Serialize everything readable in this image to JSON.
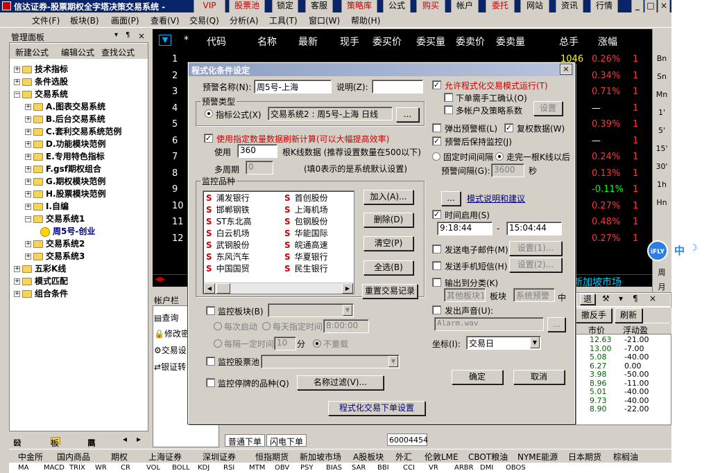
{
  "titlebar": {
    "title": "信达证券-股票期权全字塔决策交易系统 -",
    "buttons": [
      "VIP",
      "股票池",
      "锁定",
      "客服",
      "策略库",
      "公式",
      "购买",
      "帐户",
      "委托",
      "网站",
      "资讯",
      "行情"
    ]
  },
  "menubar": [
    "文件(F)",
    "板块(B)",
    "画面(P)",
    "查看(V)",
    "交易(Q)",
    "分析(A)",
    "工具(T)",
    "窗口(W)",
    "帮助(H)"
  ],
  "leftpanel": {
    "title": "管理面板",
    "tools": [
      "新建公式",
      "编辑公式",
      "查找公式"
    ],
    "tree": [
      {
        "label": "技术指标",
        "level": 0
      },
      {
        "label": "条件选股",
        "level": 0
      },
      {
        "label": "交易系统",
        "level": 0
      },
      {
        "label": "A.图表交易系统",
        "level": 1
      },
      {
        "label": "B.后台交易系统",
        "level": 1
      },
      {
        "label": "C.套利交易系统范例",
        "level": 1
      },
      {
        "label": "D.功能模块范例",
        "level": 1
      },
      {
        "label": "E.专用特色指标",
        "level": 1
      },
      {
        "label": "F.gsf期权组合",
        "level": 1
      },
      {
        "label": "G.期权模块范例",
        "level": 1
      },
      {
        "label": "H.股票模块范例",
        "level": 1
      },
      {
        "label": "I.自编",
        "level": 1
      },
      {
        "label": "交易系统1",
        "level": 1
      },
      {
        "label": "周5号-创业",
        "level": 2
      },
      {
        "label": "交易系统2",
        "level": 1
      },
      {
        "label": "交易系统3",
        "level": 1
      },
      {
        "label": "五彩K线",
        "level": 0
      },
      {
        "label": "模式匹配",
        "level": 0
      },
      {
        "label": "组合条件",
        "level": 0
      }
    ],
    "tabs": [
      "公式",
      "板块",
      "高级"
    ]
  },
  "grid": {
    "headers": [
      "*",
      "代码",
      "名称",
      "最新",
      "现手",
      "委买价",
      "委买量",
      "委卖价",
      "委卖量",
      "总手",
      "涨幅"
    ],
    "rownums": [
      "1",
      "2",
      "3",
      "4",
      "5",
      "6",
      "7",
      "8",
      "9",
      "10",
      "11",
      "12"
    ],
    "zongshou": [
      "1046",
      "",
      "",
      "",
      "",
      "",
      "",
      "",
      "",
      "",
      "",
      ""
    ],
    "zhangfu": [
      "0.26%",
      "0.34%",
      "0.71%",
      "—",
      "0.39%",
      "—",
      "0.24%",
      "0.13%",
      "-0.11%",
      "0.27%",
      "0.48%",
      "0.27%"
    ],
    "market_tab": "新加坡市场"
  },
  "vtool": [
    "Bn",
    "Sn",
    "Mn",
    "1'",
    "5'",
    "15'",
    "30'",
    "1h",
    "Hn",
    "周",
    "月",
    "季"
  ],
  "ifly": {
    "logo": "iFLY",
    "lang": "中"
  },
  "account": {
    "title": "帐户栏",
    "items": [
      "查询",
      "修改密",
      "交易设",
      "银证转"
    ]
  },
  "rightbottom": {
    "buttons": [
      "撤反手",
      "刷新"
    ],
    "headers": [
      "市价",
      "浮动盈"
    ],
    "rows": [
      [
        "12.63",
        "-21.00"
      ],
      [
        "13.00",
        "-7.00"
      ],
      [
        "5.08",
        "-40.00"
      ],
      [
        "6.27",
        "0.00"
      ],
      [
        "3.98",
        "-50.00"
      ],
      [
        "8.96",
        "-11.00"
      ],
      [
        "5.01",
        "-40.00"
      ],
      [
        "9.73",
        "-40.00"
      ],
      [
        "8.90",
        "-22.00"
      ]
    ],
    "back": "退"
  },
  "bottomtabs": [
    "普通下单",
    "闪电下单"
  ],
  "statuscode": "60004454",
  "marketbar": [
    "中金所",
    "国内商品",
    "期权",
    "上海证券",
    "深圳证券",
    "恒指期货",
    "新加坡市场",
    "A股板块",
    "外汇",
    "伦敦LME",
    "CBOT粮油",
    "NYME能源",
    "日本期货",
    "棕榈油"
  ],
  "indexbar": [
    "MA",
    "MACD",
    "TRIX",
    "WR",
    "CR",
    "VOL",
    "BOLL",
    "KDJ",
    "RSI",
    "MTM",
    "OBV",
    "PSY",
    "BIAS",
    "SAR",
    "BBI",
    "CCI",
    "VR",
    "ARBR",
    "DMI",
    "OBOS"
  ],
  "dialog": {
    "title": "程式化条件设定",
    "close": "×",
    "name_label": "预警名称(N):",
    "name_value": "周5号-上海",
    "desc_label": "说明(Z):",
    "desc_value": "",
    "type_group": "预警类型",
    "type_radio": "指标公式(X)",
    "type_value": "交易系统2 : 周5号-上海 日线",
    "type_btn": "...",
    "use_count_check": "使用指定数量数据刷新计算(可以大幅提高效率)",
    "use_label": "使用",
    "use_value": "360",
    "use_note": "根K线数据 (推荐设置数量在500以下)",
    "period_label": "多周期",
    "period_value": "0",
    "period_note": "(填0表示的是系统默认设置)",
    "stock_group": "监控品种",
    "stocks_left": [
      "浦发银行",
      "邯郸钢铁",
      "ST东北高",
      "白云机场",
      "武钢股份",
      "东风汽车",
      "中国国贸"
    ],
    "stocks_right": [
      "首创股份",
      "上海机场",
      "包钢股份",
      "华能国际",
      "皖通高速",
      "华夏银行",
      "民生银行"
    ],
    "stock_marker": "S",
    "btn_add": "加入(A)...",
    "btn_del": "删除(D)",
    "btn_clear": "清空(P)",
    "btn_all": "全选(B)",
    "btn_reset": "重置交易记录",
    "monitor_block": "监控板块(B)",
    "radio_each": "每次启动",
    "radio_daily": "每天指定时间",
    "time_daily": "8:00:00",
    "radio_interval": "每隔一定时间",
    "interval_value": "10",
    "interval_unit": "分",
    "radio_norepeat": "不重载",
    "monitor_pool": "监控股票池",
    "monitor_halt": "监控停牌的品种(Q)",
    "btn_filter": "名称过滤(V)...",
    "btn_order": "程式化交易下单设置",
    "allow_run": "允许程式化交易模式运行(T)",
    "manual_confirm": "下单需手工确认(O)",
    "multi_account": "多帐户及策略系数",
    "btn_setting": "设置",
    "popup_window": "弹出预警框(L)",
    "restore_data": "复权数据(W)",
    "keep_monitor": "预警后保持监控(J)",
    "fixed_interval": "固定时间间隔",
    "per_kline": "走完一根K线以后",
    "warn_interval_label": "预警间隔(G):",
    "warn_interval_value": "3600",
    "warn_interval_unit": "秒",
    "mode_btn": "...",
    "mode_link": "模式说明和建议",
    "time_enable": "时间启用(S)",
    "time_start": "9:18:44",
    "time_sep": "-",
    "time_end": "15:04:44",
    "send_email": "发送电子邮件(M)",
    "btn_email": "设置(1)...",
    "send_sms": "发送手机短信(H)",
    "btn_sms": "设置(2)...",
    "output_class": "输出到分类(K)",
    "output_block": "其他板块1",
    "output_block_label": "板块",
    "output_sys": "系统预警",
    "output_mid": "中",
    "sound": "发出声音(U):",
    "sound_file": "Alarm.wav",
    "sound_btn": "...",
    "coord_label": "坐标(I):",
    "coord_value": "交易日",
    "ok": "确定",
    "cancel": "取消"
  }
}
